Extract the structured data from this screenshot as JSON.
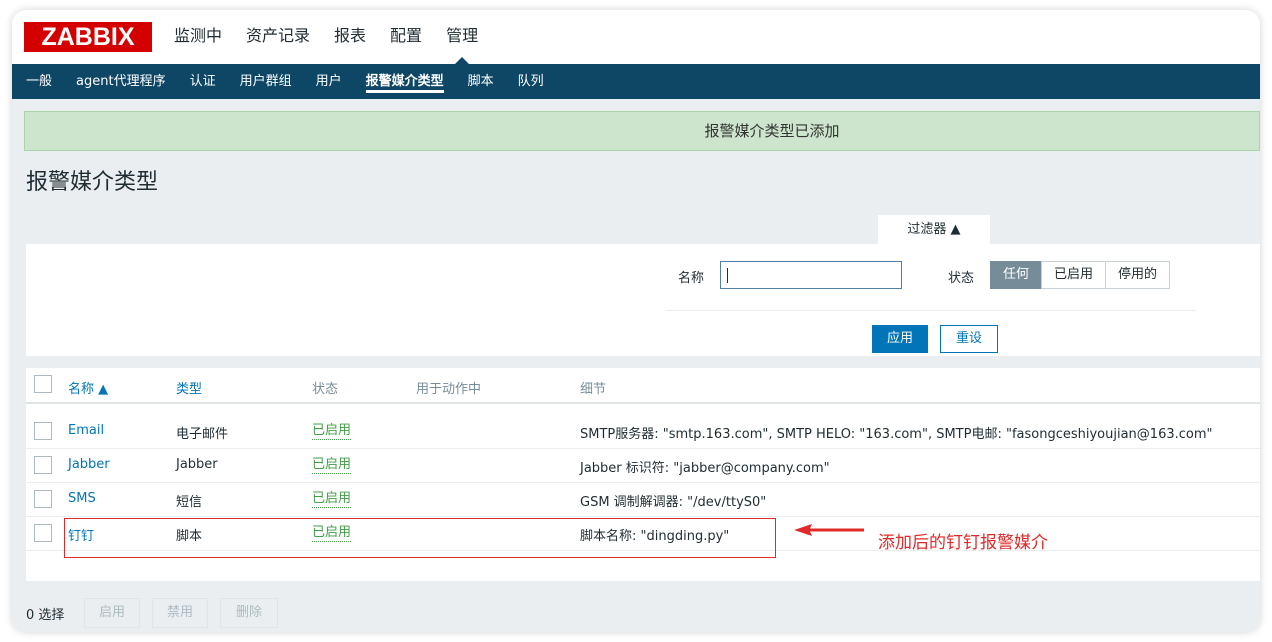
{
  "header": {
    "logo": "ZABBIX",
    "main_nav": [
      {
        "label": "监测中",
        "selected": false
      },
      {
        "label": "资产记录",
        "selected": false
      },
      {
        "label": "报表",
        "selected": false
      },
      {
        "label": "配置",
        "selected": false
      },
      {
        "label": "管理",
        "selected": true
      }
    ],
    "sub_nav": [
      {
        "label": "一般",
        "selected": false
      },
      {
        "label": "agent代理程序",
        "selected": false
      },
      {
        "label": "认证",
        "selected": false
      },
      {
        "label": "用户群组",
        "selected": false
      },
      {
        "label": "用户",
        "selected": false
      },
      {
        "label": "报警媒介类型",
        "selected": true
      },
      {
        "label": "脚本",
        "selected": false
      },
      {
        "label": "队列",
        "selected": false
      }
    ]
  },
  "message": "报警媒介类型已添加",
  "page_title": "报警媒介类型",
  "filter": {
    "tab_label": "过滤器 ▲",
    "name_label": "名称",
    "name_value": "",
    "status_label": "状态",
    "status_options": [
      "任何",
      "已启用",
      "停用的"
    ],
    "status_selected": "任何",
    "apply_label": "应用",
    "reset_label": "重设"
  },
  "table": {
    "headers": {
      "name": "名称 ▲",
      "type": "类型",
      "status": "状态",
      "used_in_actions": "用于动作中",
      "details": "细节"
    },
    "rows": [
      {
        "name": "Email",
        "type": "电子邮件",
        "status": "已启用",
        "used": "",
        "details": "SMTP服务器: \"smtp.163.com\", SMTP HELO: \"163.com\", SMTP电邮: \"fasongceshiyoujian@163.com\""
      },
      {
        "name": "Jabber",
        "type": "Jabber",
        "status": "已启用",
        "used": "",
        "details": "Jabber 标识符: \"jabber@company.com\""
      },
      {
        "name": "SMS",
        "type": "短信",
        "status": "已启用",
        "used": "",
        "details": "GSM 调制解调器: \"/dev/ttyS0\""
      },
      {
        "name": "钉钉",
        "type": "脚本",
        "status": "已启用",
        "used": "",
        "details": "脚本名称: \"dingding.py\""
      }
    ]
  },
  "annotation": {
    "text": "添加后的钉钉报警媒介",
    "color": "#e02a2a"
  },
  "footer": {
    "selected_count": "0 选择",
    "buttons": [
      "启用",
      "禁用",
      "删除"
    ]
  },
  "colors": {
    "brand": "#d40000",
    "nav_bg": "#0e4766",
    "link": "#0275b8",
    "enabled": "#429e47",
    "success_bg": "#cce5cc"
  }
}
